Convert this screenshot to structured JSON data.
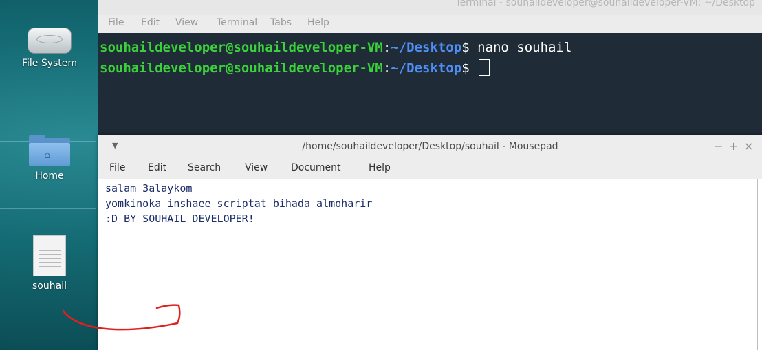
{
  "desktop": {
    "icons": [
      {
        "label": "File System",
        "icon": "drive-icon"
      },
      {
        "label": "Home",
        "icon": "home-folder-icon"
      },
      {
        "label": "souhail",
        "icon": "text-file-icon"
      }
    ]
  },
  "terminal": {
    "title": "Terminal - souhaildeveloper@souhaildeveloper-VM: ~/Desktop",
    "menu": [
      "File",
      "Edit",
      "View",
      "Terminal",
      "Tabs",
      "Help"
    ],
    "lines": [
      {
        "user": "souhaildeveloper@souhaildeveloper-VM",
        "sep": ":",
        "path": "~/Desktop",
        "symbol": "$",
        "command": " nano souhail"
      },
      {
        "user": "souhaildeveloper@souhaildeveloper-VM",
        "sep": ":",
        "path": "~/Desktop",
        "symbol": "$",
        "command": " "
      }
    ]
  },
  "mousepad": {
    "title": "/home/souhaildeveloper/Desktop/souhail - Mousepad",
    "menu": [
      "File",
      "Edit",
      "Search",
      "View",
      "Document",
      "Help"
    ],
    "controls": {
      "minimize": "−",
      "maximize": "+",
      "close": "×"
    },
    "content": [
      "salam 3alaykom",
      "yomkinoka inshaee scriptat bihada almoharir",
      ":D BY SOUHAIL DEVELOPER!"
    ]
  },
  "colors": {
    "prompt_user": "#3bd13b",
    "prompt_path": "#4e8ef5",
    "annotation_arrow": "#e0201c"
  }
}
